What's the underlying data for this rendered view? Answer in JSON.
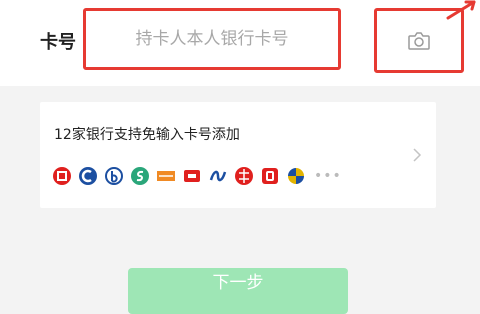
{
  "form": {
    "card_label": "卡号",
    "card_placeholder": "持卡人本人银行卡号",
    "card_value": ""
  },
  "banks": {
    "title": "12家银行支持免输入卡号添加",
    "icons": [
      {
        "name": "icbc-icon",
        "color": "#e0201e"
      },
      {
        "name": "ccb-icon",
        "color": "#1c4fa1"
      },
      {
        "name": "boc-icon",
        "color": "#1c4fa1"
      },
      {
        "name": "minsheng-icon",
        "color": "#2aa67a"
      },
      {
        "name": "pab-icon",
        "color": "#f08a24"
      },
      {
        "name": "spdb-icon",
        "color": "#e0201e"
      },
      {
        "name": "abc-icon",
        "color": "#1c4fa1"
      },
      {
        "name": "cmbc-icon",
        "color": "#e0201e"
      },
      {
        "name": "citic-icon",
        "color": "#e0201e"
      },
      {
        "name": "bocom-icon",
        "color": "#e3b400"
      }
    ],
    "more": "•••"
  },
  "actions": {
    "next_label": "下一步"
  },
  "colors": {
    "highlight": "#e63a32",
    "accent": "#9ee6b5",
    "background": "#f3f3f3"
  }
}
